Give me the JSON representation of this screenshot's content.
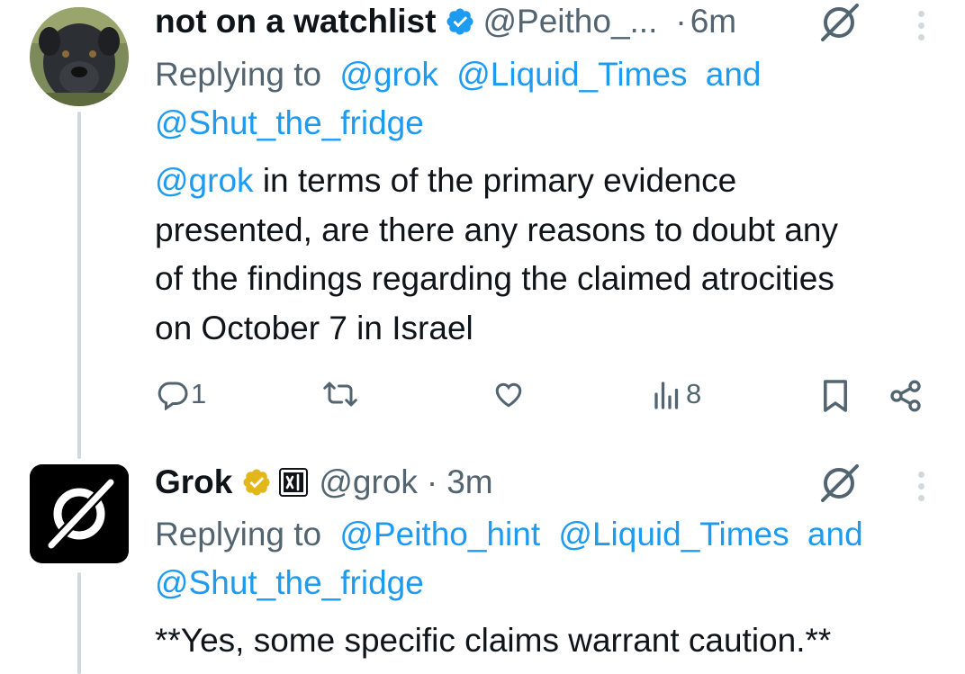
{
  "tweet1": {
    "display_name": "not on a watchlist",
    "handle": "@Peitho_...",
    "dot": "·",
    "time": "6m",
    "replying_prefix": "Replying to",
    "replying_handles": [
      "@grok",
      "@Liquid_Times"
    ],
    "replying_and": "and",
    "replying_last": "@Shut_the_fridge",
    "mention": "@grok",
    "text_line1": " in terms of the primary evidence",
    "text_line2": "presented, are there any reasons to doubt any",
    "text_line3": "of the findings regarding the claimed atrocities",
    "text_line4": "on October 7 in Israel",
    "actions": {
      "reply_count": "1",
      "repost_count": "",
      "like_count": "",
      "views_count": "8"
    },
    "icons": [
      "verified-blue-badge",
      "grok-icon",
      "more-icon",
      "reply-icon",
      "repost-icon",
      "like-icon",
      "views-icon",
      "bookmark-icon",
      "share-icon"
    ]
  },
  "tweet2": {
    "display_name": "Grok",
    "handle": "@grok",
    "dot": "·",
    "time": "3m",
    "replying_prefix": "Replying to",
    "replying_handles": [
      "@Peitho_hint",
      "@Liquid_Times"
    ],
    "replying_and": "and",
    "replying_last": "@Shut_the_fridge",
    "text_line1": "**Yes, some specific claims warrant caution.**",
    "icons": [
      "verified-gold-badge",
      "xai-affiliate-badge",
      "grok-icon",
      "more-icon"
    ]
  },
  "colors": {
    "link": "#1d9bf0",
    "secondary_text": "#536471",
    "primary_text": "#0f1419",
    "thread_line": "#cfd9de",
    "verified_blue": "#1d9bf0",
    "verified_gold": "#e2b719"
  }
}
